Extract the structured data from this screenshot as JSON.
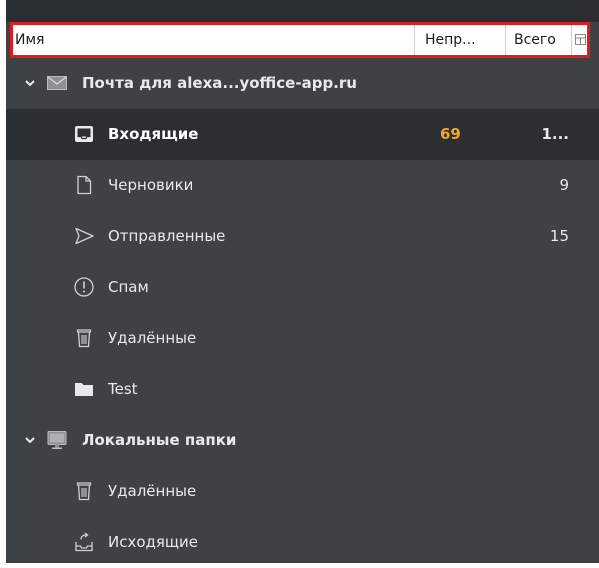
{
  "columns": {
    "name": "Имя",
    "unread": "Непр...",
    "total": "Всего",
    "picker_icon": "column-picker-icon"
  },
  "accounts": [
    {
      "name": "Почта для alexa...yoffice-app.ru",
      "icon": "mail-icon",
      "expanded": true,
      "folders": [
        {
          "name": "Входящие",
          "icon": "inbox-icon",
          "unread": "69",
          "total": "1...",
          "selected": true
        },
        {
          "name": "Черновики",
          "icon": "drafts-icon",
          "unread": "",
          "total": "9"
        },
        {
          "name": "Отправленные",
          "icon": "sent-icon",
          "unread": "",
          "total": "15"
        },
        {
          "name": "Спам",
          "icon": "spam-icon",
          "unread": "",
          "total": ""
        },
        {
          "name": "Удалённые",
          "icon": "trash-icon",
          "unread": "",
          "total": ""
        },
        {
          "name": "Test",
          "icon": "folder-icon",
          "unread": "",
          "total": ""
        }
      ]
    },
    {
      "name": "Локальные папки",
      "icon": "local-folders-icon",
      "expanded": true,
      "folders": [
        {
          "name": "Удалённые",
          "icon": "trash-icon",
          "unread": "",
          "total": ""
        },
        {
          "name": "Исходящие",
          "icon": "outbox-icon",
          "unread": "",
          "total": ""
        }
      ]
    }
  ],
  "colors": {
    "background": "#3e4245",
    "selected_row": "#2b2f33",
    "unread_count": "#f5a524",
    "header_highlight": "#e01b24"
  }
}
